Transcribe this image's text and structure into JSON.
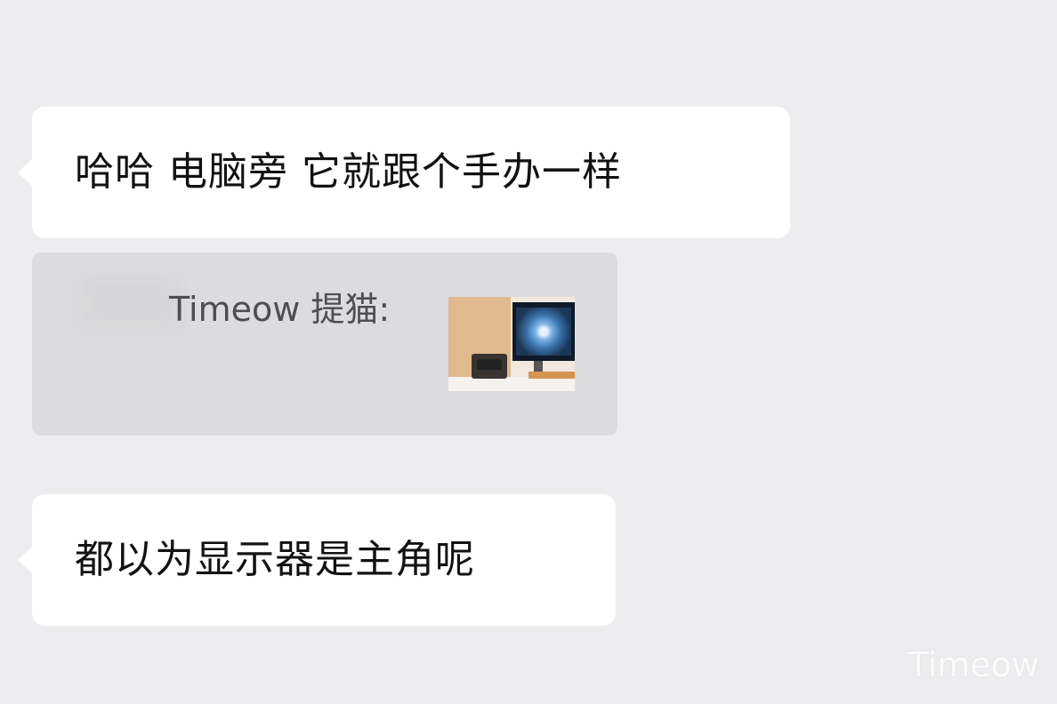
{
  "messages": [
    {
      "text": "哈哈 电脑旁 它就跟个手办一样"
    },
    {
      "text": "都以为显示器是主角呢"
    }
  ],
  "quote": {
    "sender": "Timeow 提猫:",
    "thumbnail_icon": "desk-setup-photo"
  },
  "watermark": "Timeow",
  "colors": {
    "background": "#ededf0",
    "bubble": "#ffffff",
    "quote_background": "#dcdcde",
    "text": "#121212",
    "quote_text": "#4e4e50"
  }
}
